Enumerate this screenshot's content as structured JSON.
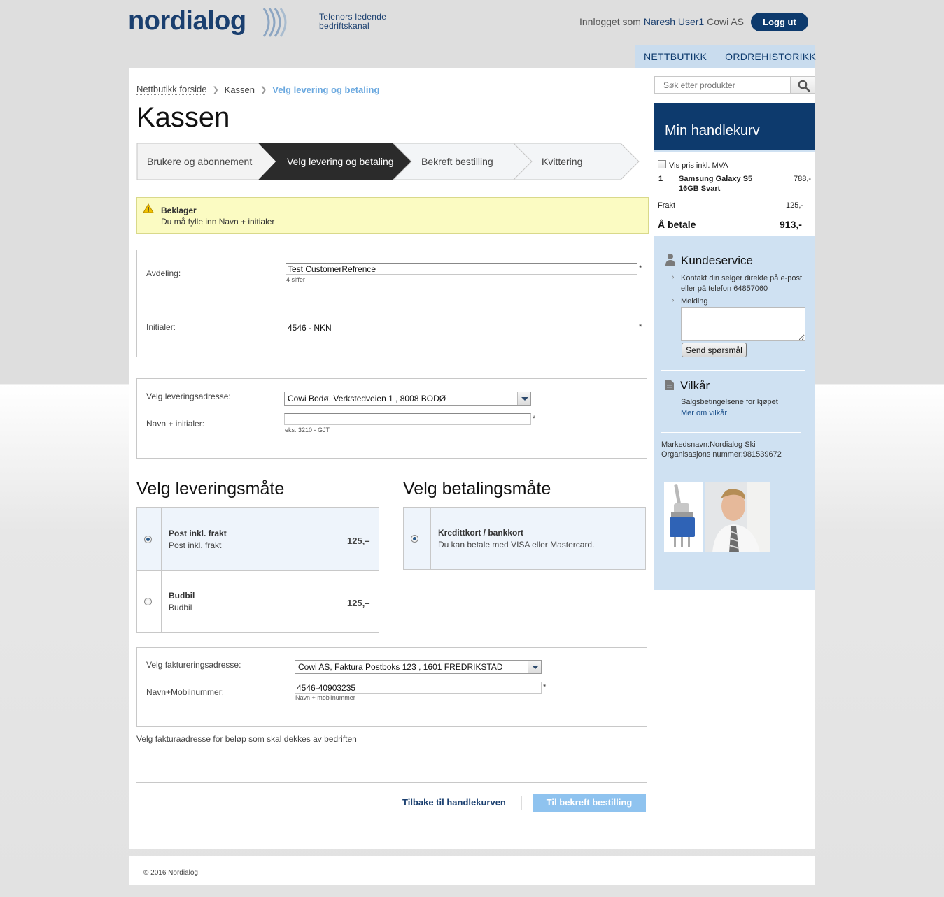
{
  "header": {
    "logo_text": "nordialog",
    "tagline_line1": "Telenors ledende",
    "tagline_line2": "bedriftskanal",
    "logged_in_prefix": "Innlogget som",
    "user_name": "Naresh User1",
    "company": "Cowi AS",
    "logout_label": "Logg ut"
  },
  "nav": {
    "items": [
      "NETTBUTIKK",
      "ORDREHISTORIKK"
    ]
  },
  "breadcrumb": {
    "items": [
      "Nettbutikk forside",
      "Kassen"
    ],
    "current": "Velg levering og betaling"
  },
  "page_title": "Kassen",
  "steps": [
    "Brukere og abonnement",
    "Velg levering og betaling",
    "Bekreft bestilling",
    "Kvittering"
  ],
  "steps_active_index": 1,
  "error": {
    "title": "Beklager",
    "message": "Du må fylle inn Navn + initialer"
  },
  "department": {
    "label": "Avdeling:",
    "value": "Test CustomerRefrence",
    "hint": "4 siffer",
    "required": "*"
  },
  "initials": {
    "label": "Initialer:",
    "value": "4546 - NKN",
    "required": "*"
  },
  "delivery_address": {
    "label": "Velg leveringsadresse:",
    "selected": "Cowi Bodø, Verkstedveien 1 , 8008 BODØ",
    "name_label": "Navn + initialer:",
    "name_value": "",
    "name_hint": "eks: 3210 - GJT",
    "required": "*"
  },
  "delivery_method": {
    "title": "Velg leveringsmåte",
    "options": [
      {
        "name": "Post inkl. frakt",
        "desc": "Post inkl. frakt",
        "price": "125,–",
        "selected": true
      },
      {
        "name": "Budbil",
        "desc": "Budbil",
        "price": "125,–",
        "selected": false
      }
    ]
  },
  "payment_method": {
    "title": "Velg betalingsmåte",
    "options": [
      {
        "name": "Kredittkort / bankkort",
        "desc": "Du kan betale med VISA eller Mastercard.",
        "selected": true
      }
    ]
  },
  "billing": {
    "label": "Velg faktureringsadresse:",
    "selected": "Cowi AS, Faktura Postboks 123 , 1601 FREDRIKSTAD",
    "name_label": "Navn+Mobilnummer:",
    "name_value": "4546-40903235",
    "name_hint": "Navn + mobilnummer",
    "required": "*",
    "note": "Velg fakturaadresse for beløp som skal dekkes av bedriften"
  },
  "actions": {
    "back_label": "Tilbake til handlekurven",
    "next_label": "Til bekreft bestilling"
  },
  "sidebar": {
    "search_placeholder": "Søk etter produkter",
    "cart": {
      "title": "Min handlekurv",
      "vat_label": "Vis pris inkl. MVA",
      "items": [
        {
          "qty": "1",
          "name_line1": "Samsung Galaxy S5",
          "name_line2": "16GB Svart",
          "price": "788,-"
        }
      ],
      "shipping_label": "Frakt",
      "shipping_price": "125,-",
      "total_label": "Å betale",
      "total_price": "913,-"
    },
    "customer_service": {
      "title": "Kundeservice",
      "contact_line1": "Kontakt din selger direkte på e-post",
      "contact_line2": "eller på telefon 64857060",
      "message_label": "Melding",
      "send_label": "Send spørsmål"
    },
    "terms": {
      "title": "Vilkår",
      "text": "Salgsbetingelsene for kjøpet",
      "link": "Mer om vilkår"
    },
    "market": {
      "name": "Markedsnavn:Nordialog Ski",
      "org": "Organisasjons nummer:981539672"
    }
  },
  "footer": {
    "copyright": "© 2016 Nordialog"
  },
  "colors": {
    "brand": "#0d3a6d",
    "accent": "#6aa8df",
    "warning_bg": "#fbfbc2",
    "sidebar_bg": "#cfe1f2"
  }
}
